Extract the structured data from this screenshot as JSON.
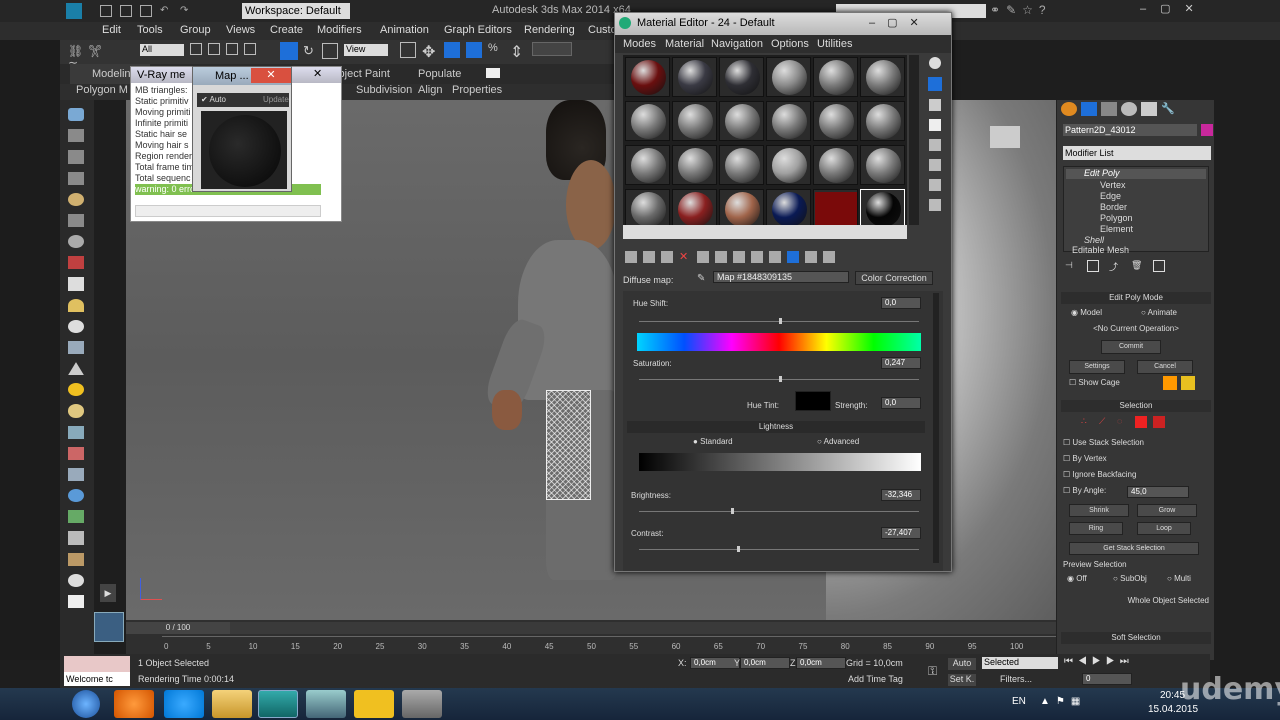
{
  "app": {
    "title": "Autodesk 3ds Max 2014 x64",
    "workspace": "Workspace: Default"
  },
  "menubar": [
    "Edit",
    "Tools",
    "Group",
    "Views",
    "Create",
    "Modifiers",
    "Animation",
    "Graph Editors",
    "Rendering",
    "Custo"
  ],
  "toolbar": {
    "selection_filter": "All",
    "ref_coord": "View"
  },
  "ribbon_tabs": [
    "Modeling",
    "Object Paint",
    "Populate"
  ],
  "ribbon_sub": [
    "Polygon M",
    "Subdivision",
    "Align",
    "Properties"
  ],
  "vray_window": {
    "title": "V-Ray me",
    "lines": [
      "MB triangles:",
      "Static primitiv",
      "Moving primiti",
      "Infinite primiti",
      "Static hair se",
      "Moving hair s",
      "Region render",
      "Total frame tim",
      "Total sequenc"
    ],
    "warning": "warning: 0 erro"
  },
  "map_window": {
    "title": "Map ...",
    "auto_label": "Auto",
    "update_label": "Update"
  },
  "material_editor": {
    "title": "Material Editor - 24 - Default",
    "menu": [
      "Modes",
      "Material",
      "Navigation",
      "Options",
      "Utilities"
    ],
    "diffuse_label": "Diffuse map:",
    "map_name": "Map #1848309135",
    "color_correction": "Color Correction",
    "hue_shift_label": "Hue Shift:",
    "hue_shift_value": "0,0",
    "saturation_label": "Saturation:",
    "saturation_value": "0,247",
    "hue_tint_label": "Hue Tint:",
    "strength_label": "Strength:",
    "strength_value": "0,0",
    "lightness_header": "Lightness",
    "standard_label": "Standard",
    "advanced_label": "Advanced",
    "brightness_label": "Brightness:",
    "brightness_value": "-32,346",
    "contrast_label": "Contrast:",
    "contrast_value": "-27,407"
  },
  "command_panel": {
    "object_name": "Pattern2D_43012",
    "modifier_list": "Modifier List",
    "stack": [
      "Edit Poly",
      "Vertex",
      "Edge",
      "Border",
      "Polygon",
      "Element",
      "Shell",
      "Editable Mesh"
    ],
    "edit_poly_mode": "Edit Poly Mode",
    "model_label": "Model",
    "animate_label": "Animate",
    "no_operation": "<No Current Operation>",
    "commit": "Commit",
    "settings": "Settings",
    "cancel": "Cancel",
    "show_cage": "Show Cage",
    "selection_header": "Selection",
    "use_stack_selection": "Use Stack Selection",
    "by_vertex": "By Vertex",
    "ignore_backfacing": "Ignore Backfacing",
    "by_angle": "By Angle:",
    "by_angle_value": "45,0",
    "shrink": "Shrink",
    "grow": "Grow",
    "ring": "Ring",
    "loop": "Loop",
    "get_stack_selection": "Get Stack Selection",
    "preview_selection": "Preview Selection",
    "off": "Off",
    "subobj": "SubObj",
    "multi": "Multi",
    "whole_object_selected": "Whole Object Selected",
    "soft_selection": "Soft Selection"
  },
  "trackbar": {
    "frame_counter": "0 / 100",
    "ticks": [
      "0",
      "5",
      "10",
      "15",
      "20",
      "25",
      "30",
      "35",
      "40",
      "45",
      "50",
      "55",
      "60",
      "65",
      "70",
      "75",
      "80",
      "85",
      "90",
      "95",
      "100"
    ]
  },
  "status": {
    "welcome": "Welcome tc",
    "selected": "1 Object Selected",
    "rendering_time": "Rendering Time  0:00:14",
    "x_value": "0,0cm",
    "y_value": "0,0cm",
    "z_value": "0,0cm",
    "grid": "Grid = 10,0cm",
    "add_time_tag": "Add Time Tag",
    "auto": "Auto",
    "set_k": "Set K.",
    "selected_dropdown": "Selected",
    "filters": "Filters...",
    "frame": "0"
  },
  "taskbar": {
    "lang": "EN",
    "time": "20:45",
    "date": "15.04.2015"
  },
  "watermark": "udemy",
  "colors": {
    "accent_blue": "#1e6fd9",
    "swatch_orange": "#ff9900",
    "swatch_yellow": "#e8c020",
    "swatch_magenta": "#c8289c",
    "warning_green": "#80c050"
  }
}
